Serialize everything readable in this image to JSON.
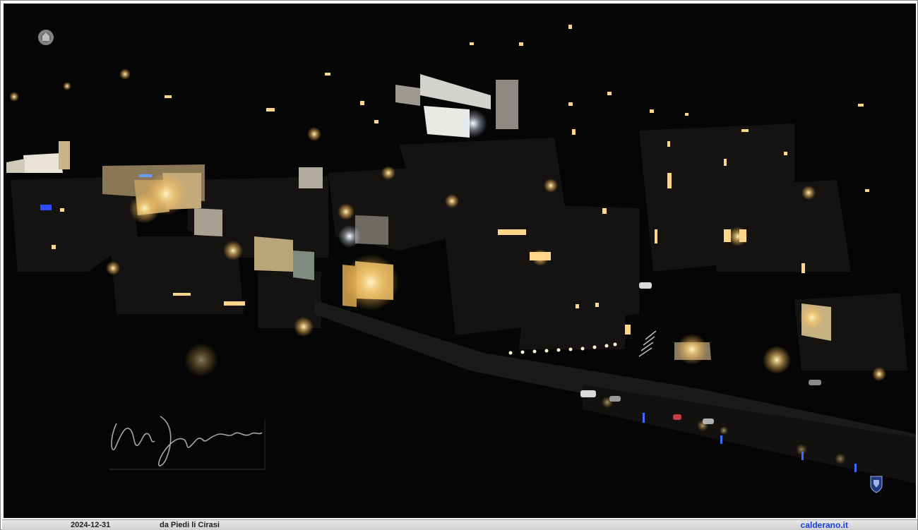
{
  "photo": {
    "subject": "night-aerial-village",
    "signature_text": "Nunzio Calderano",
    "crest_top_left": "town-crest-icon",
    "crest_bottom_right": "shield-crest-icon"
  },
  "caption": {
    "date": "2024-12-31",
    "location": "da Piedi li Cirasi",
    "site": "calderano.it"
  },
  "colors": {
    "night": "#050505",
    "light_warm": "#ffd68a",
    "light_white": "#ffffff",
    "caption_bg": "#d8d8d8",
    "link": "#1a3fd6"
  }
}
